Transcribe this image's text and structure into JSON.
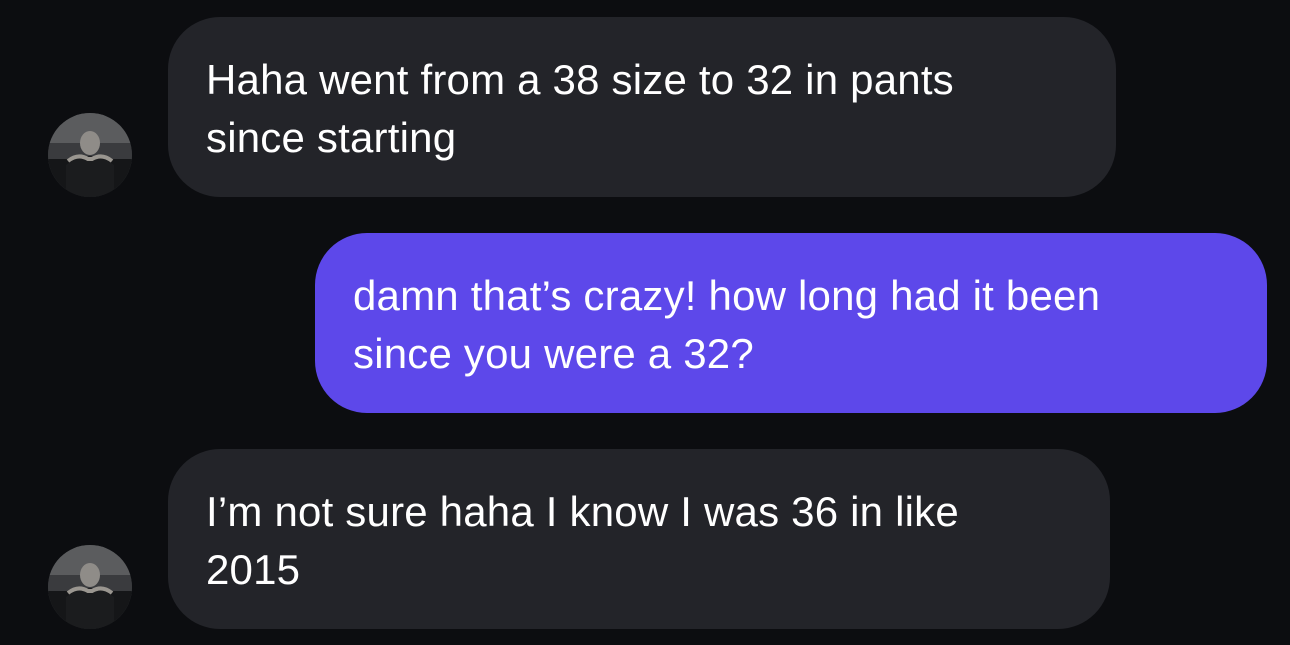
{
  "messages": [
    {
      "direction": "incoming",
      "lines": [
        "Haha went from a 38 size to 32 in pants",
        "since starting"
      ],
      "has_avatar": true
    },
    {
      "direction": "outgoing",
      "lines": [
        "damn that’s crazy! how long had it been",
        "since you were a 32?"
      ],
      "has_avatar": false
    },
    {
      "direction": "incoming",
      "lines": [
        "I’m not sure haha I know I was 36 in like",
        "2015"
      ],
      "has_avatar": true
    }
  ],
  "colors": {
    "background": "#0c0d10",
    "incoming_bubble": "#232429",
    "outgoing_bubble": "#5d48ea",
    "text": "#ffffff"
  }
}
